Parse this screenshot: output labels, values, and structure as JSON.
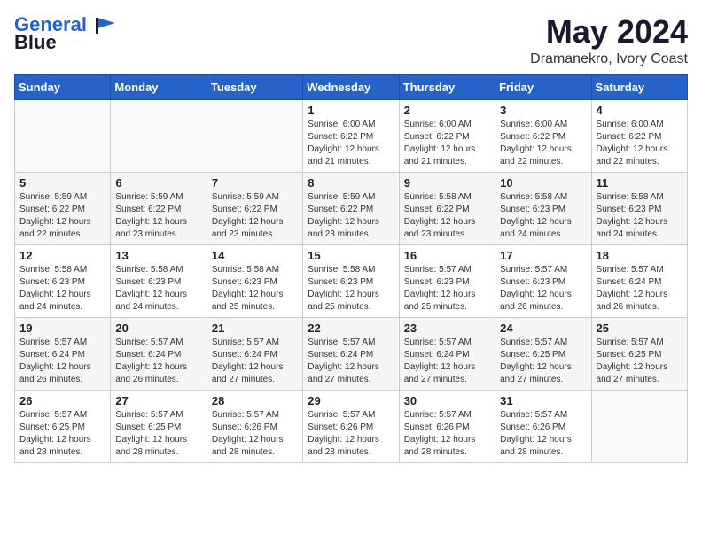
{
  "header": {
    "logo_line1": "General",
    "logo_line2": "Blue",
    "month": "May 2024",
    "location": "Dramanekro, Ivory Coast"
  },
  "weekdays": [
    "Sunday",
    "Monday",
    "Tuesday",
    "Wednesday",
    "Thursday",
    "Friday",
    "Saturday"
  ],
  "weeks": [
    [
      {
        "day": "",
        "info": ""
      },
      {
        "day": "",
        "info": ""
      },
      {
        "day": "",
        "info": ""
      },
      {
        "day": "1",
        "info": "Sunrise: 6:00 AM\nSunset: 6:22 PM\nDaylight: 12 hours\nand 21 minutes."
      },
      {
        "day": "2",
        "info": "Sunrise: 6:00 AM\nSunset: 6:22 PM\nDaylight: 12 hours\nand 21 minutes."
      },
      {
        "day": "3",
        "info": "Sunrise: 6:00 AM\nSunset: 6:22 PM\nDaylight: 12 hours\nand 22 minutes."
      },
      {
        "day": "4",
        "info": "Sunrise: 6:00 AM\nSunset: 6:22 PM\nDaylight: 12 hours\nand 22 minutes."
      }
    ],
    [
      {
        "day": "5",
        "info": "Sunrise: 5:59 AM\nSunset: 6:22 PM\nDaylight: 12 hours\nand 22 minutes."
      },
      {
        "day": "6",
        "info": "Sunrise: 5:59 AM\nSunset: 6:22 PM\nDaylight: 12 hours\nand 23 minutes."
      },
      {
        "day": "7",
        "info": "Sunrise: 5:59 AM\nSunset: 6:22 PM\nDaylight: 12 hours\nand 23 minutes."
      },
      {
        "day": "8",
        "info": "Sunrise: 5:59 AM\nSunset: 6:22 PM\nDaylight: 12 hours\nand 23 minutes."
      },
      {
        "day": "9",
        "info": "Sunrise: 5:58 AM\nSunset: 6:22 PM\nDaylight: 12 hours\nand 23 minutes."
      },
      {
        "day": "10",
        "info": "Sunrise: 5:58 AM\nSunset: 6:23 PM\nDaylight: 12 hours\nand 24 minutes."
      },
      {
        "day": "11",
        "info": "Sunrise: 5:58 AM\nSunset: 6:23 PM\nDaylight: 12 hours\nand 24 minutes."
      }
    ],
    [
      {
        "day": "12",
        "info": "Sunrise: 5:58 AM\nSunset: 6:23 PM\nDaylight: 12 hours\nand 24 minutes."
      },
      {
        "day": "13",
        "info": "Sunrise: 5:58 AM\nSunset: 6:23 PM\nDaylight: 12 hours\nand 24 minutes."
      },
      {
        "day": "14",
        "info": "Sunrise: 5:58 AM\nSunset: 6:23 PM\nDaylight: 12 hours\nand 25 minutes."
      },
      {
        "day": "15",
        "info": "Sunrise: 5:58 AM\nSunset: 6:23 PM\nDaylight: 12 hours\nand 25 minutes."
      },
      {
        "day": "16",
        "info": "Sunrise: 5:57 AM\nSunset: 6:23 PM\nDaylight: 12 hours\nand 25 minutes."
      },
      {
        "day": "17",
        "info": "Sunrise: 5:57 AM\nSunset: 6:23 PM\nDaylight: 12 hours\nand 26 minutes."
      },
      {
        "day": "18",
        "info": "Sunrise: 5:57 AM\nSunset: 6:24 PM\nDaylight: 12 hours\nand 26 minutes."
      }
    ],
    [
      {
        "day": "19",
        "info": "Sunrise: 5:57 AM\nSunset: 6:24 PM\nDaylight: 12 hours\nand 26 minutes."
      },
      {
        "day": "20",
        "info": "Sunrise: 5:57 AM\nSunset: 6:24 PM\nDaylight: 12 hours\nand 26 minutes."
      },
      {
        "day": "21",
        "info": "Sunrise: 5:57 AM\nSunset: 6:24 PM\nDaylight: 12 hours\nand 27 minutes."
      },
      {
        "day": "22",
        "info": "Sunrise: 5:57 AM\nSunset: 6:24 PM\nDaylight: 12 hours\nand 27 minutes."
      },
      {
        "day": "23",
        "info": "Sunrise: 5:57 AM\nSunset: 6:24 PM\nDaylight: 12 hours\nand 27 minutes."
      },
      {
        "day": "24",
        "info": "Sunrise: 5:57 AM\nSunset: 6:25 PM\nDaylight: 12 hours\nand 27 minutes."
      },
      {
        "day": "25",
        "info": "Sunrise: 5:57 AM\nSunset: 6:25 PM\nDaylight: 12 hours\nand 27 minutes."
      }
    ],
    [
      {
        "day": "26",
        "info": "Sunrise: 5:57 AM\nSunset: 6:25 PM\nDaylight: 12 hours\nand 28 minutes."
      },
      {
        "day": "27",
        "info": "Sunrise: 5:57 AM\nSunset: 6:25 PM\nDaylight: 12 hours\nand 28 minutes."
      },
      {
        "day": "28",
        "info": "Sunrise: 5:57 AM\nSunset: 6:26 PM\nDaylight: 12 hours\nand 28 minutes."
      },
      {
        "day": "29",
        "info": "Sunrise: 5:57 AM\nSunset: 6:26 PM\nDaylight: 12 hours\nand 28 minutes."
      },
      {
        "day": "30",
        "info": "Sunrise: 5:57 AM\nSunset: 6:26 PM\nDaylight: 12 hours\nand 28 minutes."
      },
      {
        "day": "31",
        "info": "Sunrise: 5:57 AM\nSunset: 6:26 PM\nDaylight: 12 hours\nand 28 minutes."
      },
      {
        "day": "",
        "info": ""
      }
    ]
  ]
}
